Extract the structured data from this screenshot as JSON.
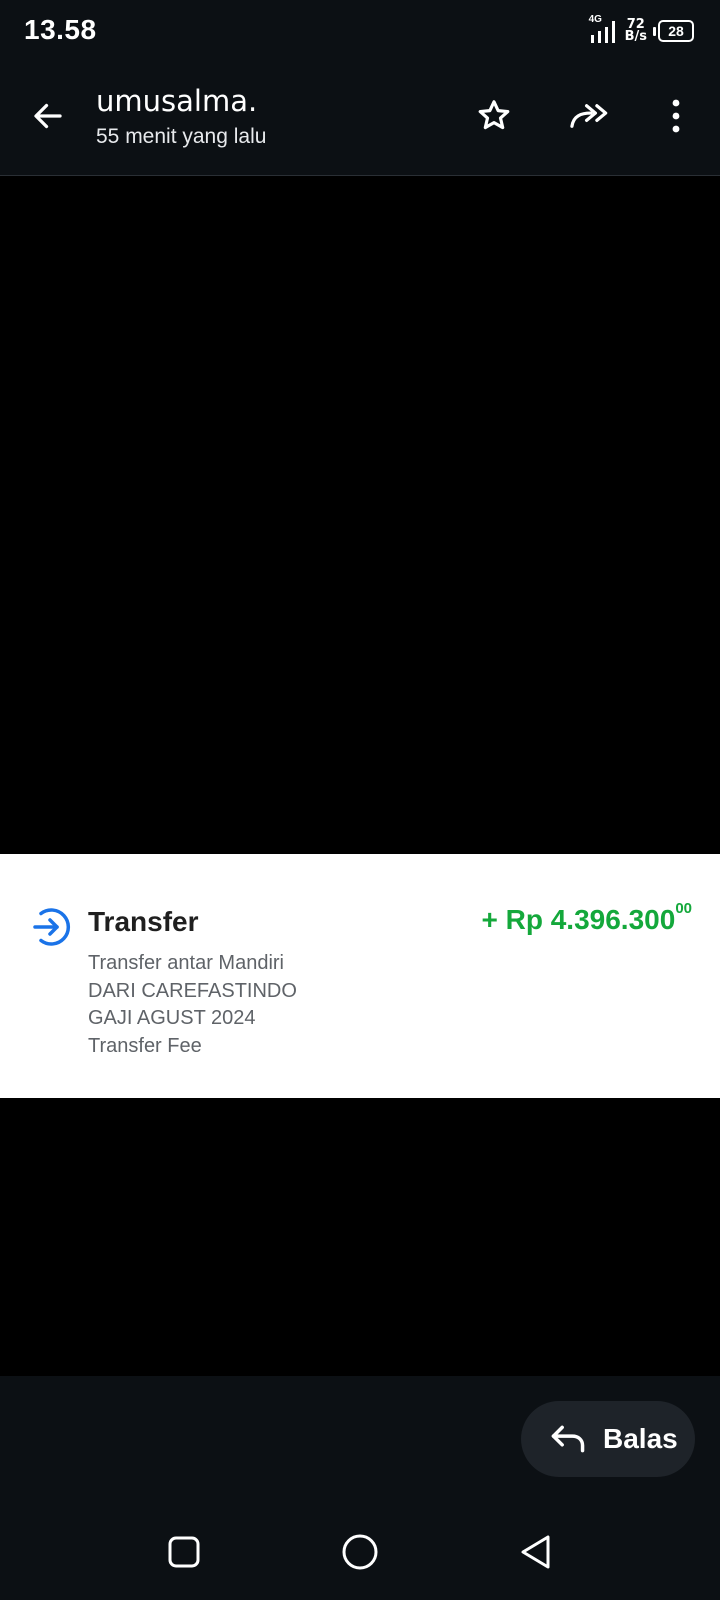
{
  "status_bar": {
    "time": "13.58",
    "network_type": "4G",
    "speed_value": "72",
    "speed_unit": "B/s",
    "battery": "28"
  },
  "header": {
    "sender": "umusalma.",
    "sent_time": "55 menit yang lalu",
    "icons": [
      "back-arrow-icon",
      "star-icon",
      "forward-icon",
      "more-vertical-icon"
    ]
  },
  "transaction": {
    "title": "Transfer",
    "amount": "+ Rp 4.396.300",
    "amount_cents": "00",
    "lines": [
      "Transfer antar Mandiri",
      "DARI CAREFASTINDO",
      "GAJI AGUST 2024",
      "Transfer Fee"
    ],
    "icon": "transfer-in-icon"
  },
  "reply": {
    "label": "Balas",
    "icon": "reply-icon"
  },
  "nav": {
    "icons": [
      "recent-apps-icon",
      "home-icon",
      "back-icon"
    ]
  },
  "colors": {
    "background": "#000000",
    "bars": "#0c1014",
    "amount_green": "#14a83b",
    "transfer_blue": "#1a73e8",
    "reply_button": "#1e2329"
  }
}
